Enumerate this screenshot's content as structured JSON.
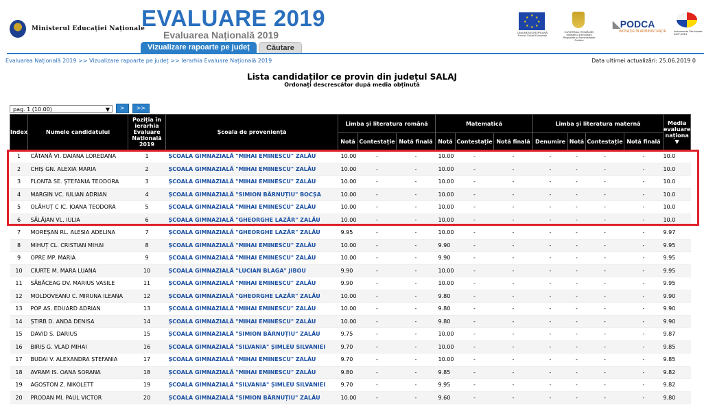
{
  "header": {
    "ministry": "Ministerul Educației Naționale",
    "title": "EVALUARE 2019",
    "subtitle": "Evaluarea Națională 2019",
    "tabs": [
      {
        "label": "Vizualizare rapoarte pe județ",
        "active": true
      },
      {
        "label": "Căutare",
        "active": false
      }
    ],
    "podca": "PODCA",
    "podca_sub": "INOVAȚIE ÎN ADMINISTRAȚIE",
    "eu_caption": "UNIUNEA EUROPEANĂ Fondul Social European",
    "gov_caption": "GUVERNUL ROMÂNIEI Ministerul Dezvoltării Regionale și Administrației Publice",
    "instr_caption": "Instrumente Structurale 2007-2013"
  },
  "breadcrumb": {
    "items": [
      "Evaluarea Națională 2019",
      "Vizualizare rapoarte pe județ",
      "Ierarhia Evaluare Națională 2019"
    ],
    "separator": ">>"
  },
  "last_update": "Data ultimei actualizări: 25.06.2019 0",
  "list": {
    "title": "Lista candidaților ce provin din județul SALAJ",
    "subtitle": "Ordonați descrescător după media obținută"
  },
  "pager": {
    "selected": "pag. 1 (10.00)",
    "next_label": ">",
    "last_label": ">>"
  },
  "table": {
    "headers": {
      "index": "Index",
      "name": "Numele candidatului",
      "position": "Poziția în ierarhia Evaluare Națională 2019",
      "school": "Școala de proveniență",
      "romana": "Limba și literatura română",
      "mate": "Matematică",
      "materna": "Limba și literatura maternă",
      "media": "Media evaluare naționa",
      "nota": "Notă",
      "contestatie": "Contestație",
      "nota_finala": "Notă finală",
      "denumire": "Denumire"
    },
    "rows": [
      [
        "1",
        "CĂTANĂ VI. DAIANA LOREDANA",
        "1",
        "ȘCOALA GIMNAZIALĂ \"MIHAI EMINESCU\" ZALĂU",
        "10.00",
        "-",
        "-",
        "10.00",
        "-",
        "-",
        "-",
        "-",
        "-",
        "-",
        "10.0"
      ],
      [
        "2",
        "CHIȘ GN. ALEXIA MARIA",
        "2",
        "ȘCOALA GIMNAZIALĂ \"MIHAI EMINESCU\" ZALĂU",
        "10.00",
        "-",
        "-",
        "10.00",
        "-",
        "-",
        "-",
        "-",
        "-",
        "-",
        "10.0"
      ],
      [
        "3",
        "FLONTA SE. ȘTEFANIA TEODORA",
        "3",
        "ȘCOALA GIMNAZIALĂ \"MIHAI EMINESCU\" ZALĂU",
        "10.00",
        "-",
        "-",
        "10.00",
        "-",
        "-",
        "-",
        "-",
        "-",
        "-",
        "10.0"
      ],
      [
        "4",
        "MARGIN VC. IULIAN ADRIAN",
        "4",
        "ȘCOALA GIMNAZIALĂ \"SIMION BĂRNUȚIU\" BOCȘA",
        "10.00",
        "-",
        "-",
        "10.00",
        "-",
        "-",
        "-",
        "-",
        "-",
        "-",
        "10.0"
      ],
      [
        "5",
        "OLĂHUȚ C IC. IOANA TEODORA",
        "5",
        "ȘCOALA GIMNAZIALĂ \"MIHAI EMINESCU\" ZALĂU",
        "10.00",
        "-",
        "-",
        "10.00",
        "-",
        "-",
        "-",
        "-",
        "-",
        "-",
        "10.0"
      ],
      [
        "6",
        "SĂLĂJAN VL. IULIA",
        "6",
        "ȘCOALA GIMNAZIALĂ \"GHEORGHE LAZĂR\" ZALĂU",
        "10.00",
        "-",
        "-",
        "10.00",
        "-",
        "-",
        "-",
        "-",
        "-",
        "-",
        "10.0"
      ],
      [
        "7",
        "MOREȘAN RL. ALESIA ADELINA",
        "7",
        "ȘCOALA GIMNAZIALĂ \"GHEORGHE LAZĂR\" ZALĂU",
        "9.95",
        "-",
        "-",
        "10.00",
        "-",
        "-",
        "-",
        "-",
        "-",
        "-",
        "9.97"
      ],
      [
        "8",
        "MIHUȚ CL. CRISTIAN MIHAI",
        "8",
        "ȘCOALA GIMNAZIALĂ \"MIHAI EMINESCU\" ZALĂU",
        "10.00",
        "-",
        "-",
        "9.90",
        "-",
        "-",
        "-",
        "-",
        "-",
        "-",
        "9.95"
      ],
      [
        "9",
        "OPRE MP. MARIA",
        "9",
        "ȘCOALA GIMNAZIALĂ \"MIHAI EMINESCU\" ZALĂU",
        "10.00",
        "-",
        "-",
        "9.90",
        "-",
        "-",
        "-",
        "-",
        "-",
        "-",
        "9.95"
      ],
      [
        "10",
        "CIURTE M. MARA LUANA",
        "10",
        "ȘCOALA GIMNAZIALĂ \"LUCIAN BLAGA\" JIBOU",
        "9.90",
        "-",
        "-",
        "10.00",
        "-",
        "-",
        "-",
        "-",
        "-",
        "-",
        "9.95"
      ],
      [
        "11",
        "SĂBĂCEAG DV. MARIUS VASILE",
        "11",
        "ȘCOALA GIMNAZIALĂ \"MIHAI EMINESCU\" ZALĂU",
        "9.90",
        "-",
        "-",
        "10.00",
        "-",
        "-",
        "-",
        "-",
        "-",
        "-",
        "9.95"
      ],
      [
        "12",
        "MOLDOVEANU C. MIRUNA ILEANA",
        "12",
        "ȘCOALA GIMNAZIALĂ \"GHEORGHE LAZĂR\" ZALĂU",
        "10.00",
        "-",
        "-",
        "9.80",
        "-",
        "-",
        "-",
        "-",
        "-",
        "-",
        "9.90"
      ],
      [
        "13",
        "POP AS. EDUARD ADRIAN",
        "13",
        "ȘCOALA GIMNAZIALĂ \"MIHAI EMINESCU\" ZALĂU",
        "10.00",
        "-",
        "-",
        "9.80",
        "-",
        "-",
        "-",
        "-",
        "-",
        "-",
        "9.90"
      ],
      [
        "14",
        "ȘTIRB D. ANDA DENISA",
        "14",
        "ȘCOALA GIMNAZIALĂ \"MIHAI EMINESCU\" ZALĂU",
        "10.00",
        "-",
        "-",
        "9.80",
        "-",
        "-",
        "-",
        "-",
        "-",
        "-",
        "9.90"
      ],
      [
        "15",
        "DAVID S. DARIUS",
        "15",
        "ȘCOALA GIMNAZIALĂ \"SIMION BĂRNUȚIU\" ZALĂU",
        "9.75",
        "-",
        "-",
        "10.00",
        "-",
        "-",
        "-",
        "-",
        "-",
        "-",
        "9.87"
      ],
      [
        "16",
        "BIRIȘ G. VLAD MIHAI",
        "16",
        "ȘCOALA GIMNAZIALĂ \"SILVANIA\" ȘIMLEU SILVANIEI",
        "9.70",
        "-",
        "-",
        "10.00",
        "-",
        "-",
        "-",
        "-",
        "-",
        "-",
        "9.85"
      ],
      [
        "17",
        "BUDAI V. ALEXANDRA ȘTEFANIA",
        "17",
        "ȘCOALA GIMNAZIALĂ \"MIHAI EMINESCU\" ZALĂU",
        "9.70",
        "-",
        "-",
        "10.00",
        "-",
        "-",
        "-",
        "-",
        "-",
        "-",
        "9.85"
      ],
      [
        "18",
        "AVRAM IS. OANA SORANA",
        "18",
        "ȘCOALA GIMNAZIALĂ \"MIHAI EMINESCU\" ZALĂU",
        "9.80",
        "-",
        "-",
        "9.85",
        "-",
        "-",
        "-",
        "-",
        "-",
        "-",
        "9.82"
      ],
      [
        "19",
        "AGOSTON Z. NIKOLETT",
        "19",
        "ȘCOALA GIMNAZIALĂ \"SILVANIA\" ȘIMLEU SILVANIEI",
        "9.70",
        "-",
        "-",
        "9.95",
        "-",
        "-",
        "-",
        "-",
        "-",
        "-",
        "9.82"
      ],
      [
        "20",
        "PRODAN MI. PAUL VICTOR",
        "20",
        "ȘCOALA GIMNAZIALĂ \"SIMION BĂRNUȚIU\" ZALĂU",
        "10.00",
        "-",
        "-",
        "9.60",
        "-",
        "-",
        "-",
        "-",
        "-",
        "-",
        "9.80"
      ]
    ]
  },
  "colors": {
    "accent": "#2a7fc8",
    "title_blue": "#2a6fbe",
    "highlight_border": "#e0202a",
    "header_bg": "#000000"
  }
}
